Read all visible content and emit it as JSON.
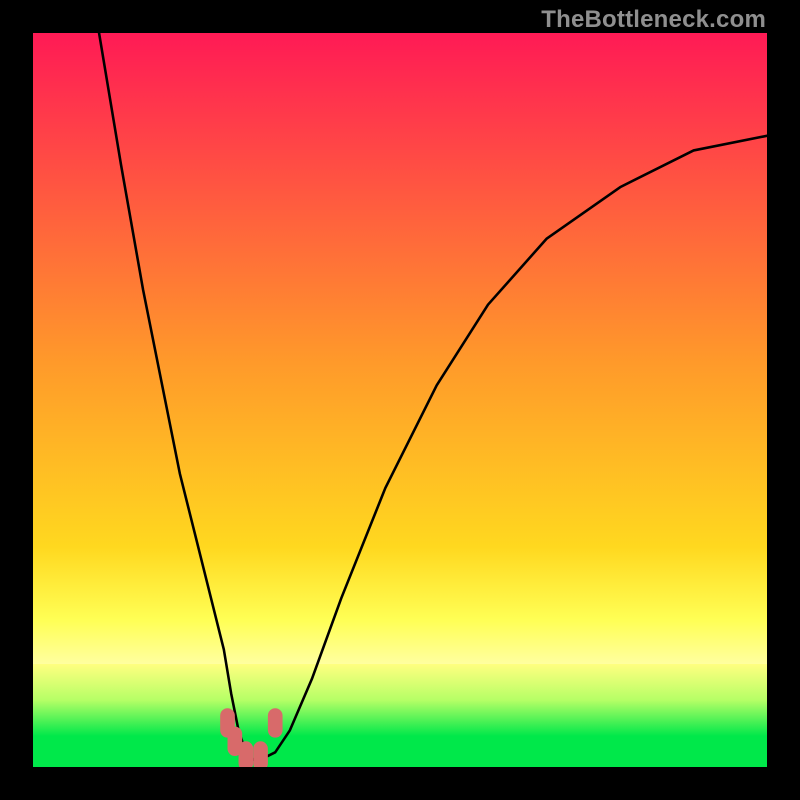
{
  "watermark": "TheBottleneck.com",
  "colors": {
    "black": "#000000",
    "red_top": "#ff1a55",
    "mid": "#ffd400",
    "yellow_pale": "#ffff80",
    "green_light": "#b6ff66",
    "green": "#00e84a",
    "marker": "#d86a6a",
    "curve": "#000000"
  },
  "chart_data": {
    "type": "line",
    "title": "",
    "xlabel": "",
    "ylabel": "",
    "xlim": [
      0,
      100
    ],
    "ylim": [
      0,
      100
    ],
    "series": [
      {
        "name": "bottleneck-curve",
        "x": [
          9,
          12,
          15,
          18,
          20,
          22,
          24,
          26,
          27,
          28,
          29,
          30,
          31,
          33,
          35,
          38,
          42,
          48,
          55,
          62,
          70,
          80,
          90,
          100
        ],
        "y": [
          100,
          82,
          65,
          50,
          40,
          32,
          24,
          16,
          10,
          5,
          2,
          1,
          1,
          2,
          5,
          12,
          23,
          38,
          52,
          63,
          72,
          79,
          84,
          86
        ]
      }
    ],
    "markers": {
      "name": "highlight-points",
      "x": [
        26.5,
        27.5,
        29,
        31,
        33
      ],
      "y": [
        6,
        3.5,
        1.5,
        1.5,
        6
      ]
    },
    "gradient_stops": [
      {
        "offset": 0.0,
        "color": "#ff1a55"
      },
      {
        "offset": 0.45,
        "color": "#ff9a2a"
      },
      {
        "offset": 0.7,
        "color": "#ffd81f"
      },
      {
        "offset": 0.8,
        "color": "#ffff55"
      },
      {
        "offset": 0.86,
        "color": "#ffffa0"
      }
    ],
    "green_band": {
      "top_pct": 86,
      "bottom_pct": 100
    }
  }
}
